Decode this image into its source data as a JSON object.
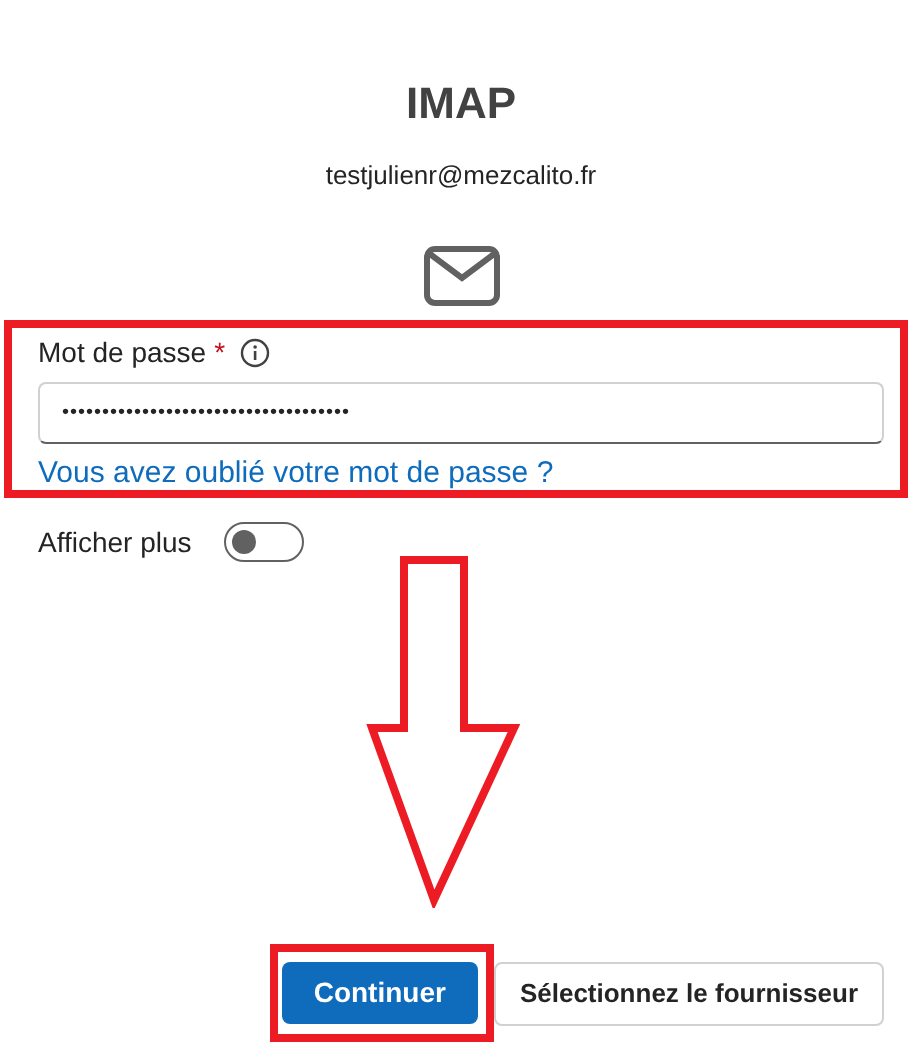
{
  "title": "IMAP",
  "email": "testjulienr@mezcalito.fr",
  "password": {
    "label": "Mot de passe",
    "required_mark": "*",
    "value": "••••••••••••••••••••••••••••••••••••"
  },
  "forgot_link": "Vous avez oublié votre mot de passe ?",
  "show_more": {
    "label": "Afficher plus",
    "on": false
  },
  "buttons": [
    {
      "label": "Continuer",
      "kind": "primary"
    },
    {
      "label": "Sélectionnez le fournisseur",
      "kind": "secondary"
    }
  ]
}
